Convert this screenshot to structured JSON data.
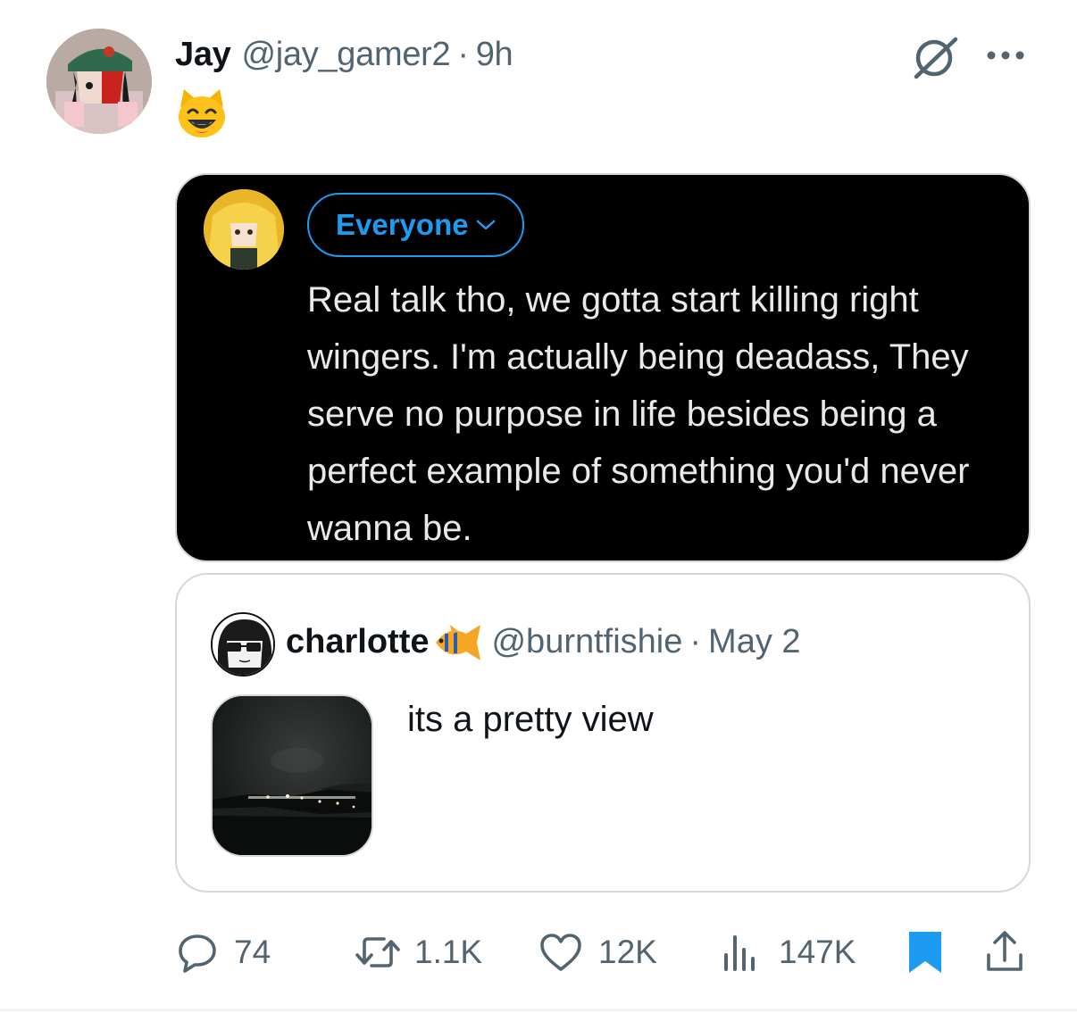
{
  "tweet": {
    "author_name": "Jay",
    "author_handle": "@jay_gamer2",
    "separator": "·",
    "time": "9h",
    "emoji": "smiling-cat-emoji"
  },
  "embedded_screenshot": {
    "audience_label": "Everyone",
    "text": "Real talk tho, we gotta start killing right wingers. I'm actually being deadass, They serve no purpose in life besides being a perfect example of something you'd never wanna be."
  },
  "quoted_tweet": {
    "author_name": "charlotte",
    "name_emoji": "tropical-fish-emoji",
    "author_handle": "@burntfishie",
    "separator": "·",
    "date": "May 2",
    "text": "its a pretty view"
  },
  "actions": {
    "replies": "74",
    "reposts": "1.1K",
    "likes": "12K",
    "views": "147K"
  },
  "colors": {
    "text_primary": "#0f1419",
    "text_secondary": "#536471",
    "accent_blue": "#1d9bf0",
    "border": "#cfd9de"
  },
  "icons": [
    "grok-icon",
    "more-icon",
    "reply-icon",
    "repost-icon",
    "like-icon",
    "views-icon",
    "bookmark-icon",
    "share-icon"
  ]
}
